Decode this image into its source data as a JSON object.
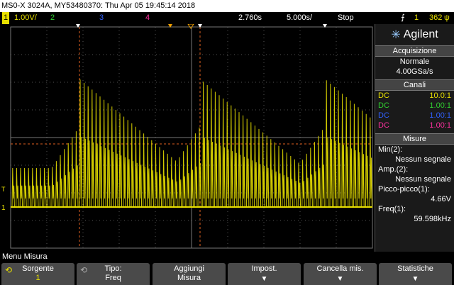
{
  "title": "MS0-X 3024A, MY53480370: Thu Apr 05 19:45:14 2018",
  "status": {
    "ch1_num": "1",
    "ch1_scale": "1.00V/",
    "ch2_num": "2",
    "ch3_num": "3",
    "ch4_num": "4",
    "time_delay": "2.760s",
    "time_scale": "5.000s/",
    "run_state": "Stop",
    "trig_icon": "trigger-edge-icon",
    "trig_ch": "1",
    "trig_level": "362",
    "trig_unit": "ψ"
  },
  "colors": {
    "ch1": "#e8e000",
    "ch2": "#30d030",
    "ch3": "#3060ff",
    "ch4": "#ff30a0",
    "grid": "#555555",
    "cursor": "#e06020"
  },
  "panel": {
    "logo": "Agilent",
    "acq_title": "Acquisizione",
    "acq_mode": "Normale",
    "acq_rate": "4.00GSa/s",
    "channels_title": "Canali",
    "channels": [
      {
        "coupling": "DC",
        "probe": "10.0:1",
        "color": "#e8e000"
      },
      {
        "coupling": "DC",
        "probe": "1.00:1",
        "color": "#30d030"
      },
      {
        "coupling": "DC",
        "probe": "1.00:1",
        "color": "#3060ff"
      },
      {
        "coupling": "DC",
        "probe": "1.00:1",
        "color": "#ff30a0"
      }
    ],
    "measure_title": "Misure",
    "measures": [
      {
        "label": "Min(2):",
        "value": "Nessun segnale"
      },
      {
        "label": "Amp.(2):",
        "value": "Nessun segnale"
      },
      {
        "label": "Picco-picco(1):",
        "value": "4.66V"
      },
      {
        "label": "Freq(1):",
        "value": "59.598kHz"
      }
    ]
  },
  "menu_title": "Menu Misura",
  "softkeys": [
    {
      "line1": "Sorgente",
      "line2": "1"
    },
    {
      "line1": "Tipo:",
      "line2": "Freq"
    },
    {
      "line1": "Aggiungi",
      "line2": "Misura"
    },
    {
      "line1": "Impost.",
      "line2": ""
    },
    {
      "line1": "Cancella mis.",
      "line2": ""
    },
    {
      "line1": "Statistiche",
      "line2": ""
    }
  ]
}
